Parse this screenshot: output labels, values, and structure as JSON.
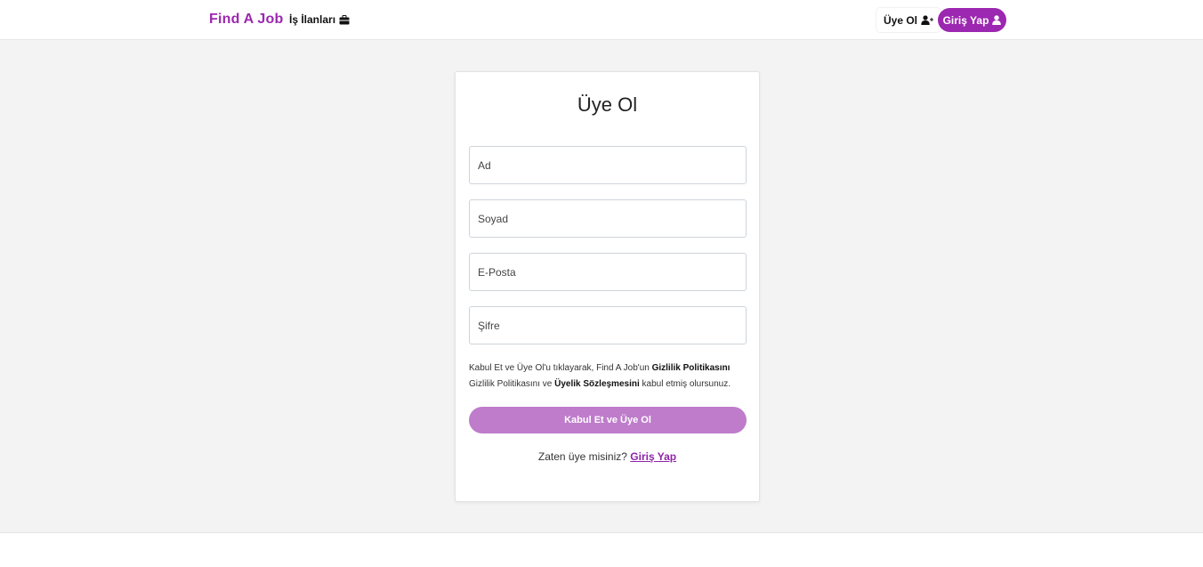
{
  "navbar": {
    "brand": "Find A Job",
    "jobs_link": "İş İlanları",
    "jobs_icon": "briefcase-icon",
    "register_label": "Üye Ol",
    "register_icon": "user-plus-icon",
    "login_label": "Giriş Yap",
    "login_icon": "user-icon",
    "accent_color": "#9c27b0"
  },
  "form": {
    "title": "Üye Ol",
    "fields": [
      {
        "placeholder": "Ad",
        "value": ""
      },
      {
        "placeholder": "Soyad",
        "value": ""
      },
      {
        "placeholder": "E-Posta",
        "value": ""
      },
      {
        "placeholder": "Şifre",
        "value": ""
      }
    ],
    "terms": {
      "prefix": "Kabul Et ve Üye Ol'u tıklayarak, Find A Job'un ",
      "privacy_bold": "Gizlilik Politikasını",
      "middle": " Gizlilik Politikasını ve ",
      "agreement_bold": "Üyelik Sözleşmesini",
      "suffix": " kabul etmiş olursunuz."
    },
    "submit_label": "Kabul Et ve Üye Ol",
    "submit_color": "#be7ccb",
    "login_prompt": "Zaten üye misiniz?",
    "login_link": "Giriş Yap"
  }
}
